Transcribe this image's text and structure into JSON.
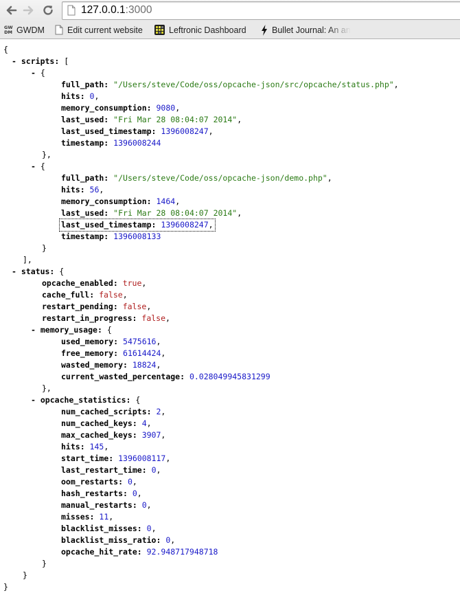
{
  "browser": {
    "address_host": "127.0.0.1",
    "address_port": ":3000",
    "bookmarks": [
      {
        "label": "GWDM",
        "icon": "gwdm-icon",
        "icon_text_top": "GW",
        "icon_text_bottom": "DM"
      },
      {
        "label": "Edit current website",
        "icon": "page-icon"
      },
      {
        "label": "Leftronic Dashboard",
        "icon": "leftronic-grid-icon"
      },
      {
        "label": "Bullet Journal: An an",
        "icon": "lightning-icon"
      }
    ]
  },
  "json_viewer": {
    "root_open": "{",
    "root_close": "}",
    "scripts": {
      "toggle": "-",
      "key": "scripts",
      "open": "[",
      "close": "],",
      "items": [
        {
          "toggle": "-",
          "open": "{",
          "close": "},",
          "full_path": "\"/Users/steve/Code/oss/opcache-json/src/opcache/status.php\"",
          "hits": "0",
          "memory_consumption": "9080",
          "last_used": "\"Fri Mar 28 08:04:07 2014\"",
          "last_used_timestamp": "1396008247",
          "timestamp": "1396008244"
        },
        {
          "toggle": "-",
          "open": "{",
          "close": "}",
          "full_path": "\"/Users/steve/Code/oss/opcache-json/demo.php\"",
          "hits": "56",
          "memory_consumption": "1464",
          "last_used": "\"Fri Mar 28 08:04:07 2014\"",
          "last_used_timestamp": "1396008247",
          "timestamp": "1396008133"
        }
      ]
    },
    "status": {
      "toggle": "-",
      "key": "status",
      "open": "{",
      "close": "}",
      "opcache_enabled": "true",
      "cache_full": "false",
      "restart_pending": "false",
      "restart_in_progress": "false",
      "memory_usage": {
        "toggle": "-",
        "key": "memory_usage",
        "open": "{",
        "close": "},",
        "used_memory": "5475616",
        "free_memory": "61614424",
        "wasted_memory": "18824",
        "current_wasted_percentage": "0.028049945831299"
      },
      "opcache_statistics": {
        "toggle": "-",
        "key": "opcache_statistics",
        "open": "{",
        "close": "}",
        "num_cached_scripts": "2",
        "num_cached_keys": "4",
        "max_cached_keys": "3907",
        "hits": "145",
        "start_time": "1396008117",
        "last_restart_time": "0",
        "oom_restarts": "0",
        "hash_restarts": "0",
        "manual_restarts": "0",
        "misses": "11",
        "blacklist_misses": "0",
        "blacklist_miss_ratio": "0",
        "opcache_hit_rate": "92.948717948718"
      }
    }
  }
}
